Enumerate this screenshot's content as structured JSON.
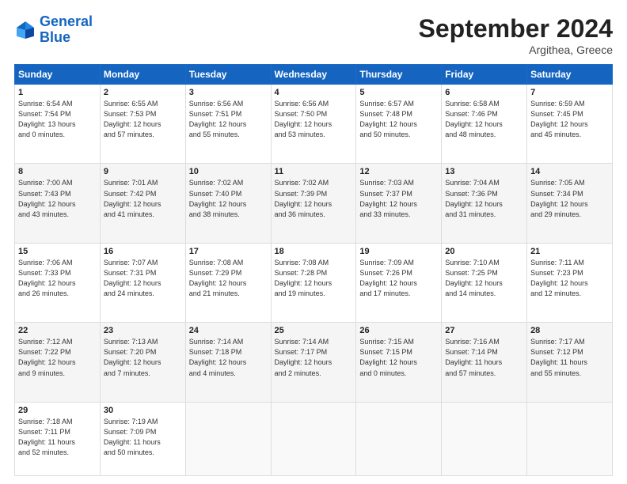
{
  "logo": {
    "text_general": "General",
    "text_blue": "Blue"
  },
  "header": {
    "month": "September 2024",
    "location": "Argithea, Greece"
  },
  "weekdays": [
    "Sunday",
    "Monday",
    "Tuesday",
    "Wednesday",
    "Thursday",
    "Friday",
    "Saturday"
  ],
  "weeks": [
    [
      {
        "day": "1",
        "info": "Sunrise: 6:54 AM\nSunset: 7:54 PM\nDaylight: 13 hours\nand 0 minutes."
      },
      {
        "day": "2",
        "info": "Sunrise: 6:55 AM\nSunset: 7:53 PM\nDaylight: 12 hours\nand 57 minutes."
      },
      {
        "day": "3",
        "info": "Sunrise: 6:56 AM\nSunset: 7:51 PM\nDaylight: 12 hours\nand 55 minutes."
      },
      {
        "day": "4",
        "info": "Sunrise: 6:56 AM\nSunset: 7:50 PM\nDaylight: 12 hours\nand 53 minutes."
      },
      {
        "day": "5",
        "info": "Sunrise: 6:57 AM\nSunset: 7:48 PM\nDaylight: 12 hours\nand 50 minutes."
      },
      {
        "day": "6",
        "info": "Sunrise: 6:58 AM\nSunset: 7:46 PM\nDaylight: 12 hours\nand 48 minutes."
      },
      {
        "day": "7",
        "info": "Sunrise: 6:59 AM\nSunset: 7:45 PM\nDaylight: 12 hours\nand 45 minutes."
      }
    ],
    [
      {
        "day": "8",
        "info": "Sunrise: 7:00 AM\nSunset: 7:43 PM\nDaylight: 12 hours\nand 43 minutes."
      },
      {
        "day": "9",
        "info": "Sunrise: 7:01 AM\nSunset: 7:42 PM\nDaylight: 12 hours\nand 41 minutes."
      },
      {
        "day": "10",
        "info": "Sunrise: 7:02 AM\nSunset: 7:40 PM\nDaylight: 12 hours\nand 38 minutes."
      },
      {
        "day": "11",
        "info": "Sunrise: 7:02 AM\nSunset: 7:39 PM\nDaylight: 12 hours\nand 36 minutes."
      },
      {
        "day": "12",
        "info": "Sunrise: 7:03 AM\nSunset: 7:37 PM\nDaylight: 12 hours\nand 33 minutes."
      },
      {
        "day": "13",
        "info": "Sunrise: 7:04 AM\nSunset: 7:36 PM\nDaylight: 12 hours\nand 31 minutes."
      },
      {
        "day": "14",
        "info": "Sunrise: 7:05 AM\nSunset: 7:34 PM\nDaylight: 12 hours\nand 29 minutes."
      }
    ],
    [
      {
        "day": "15",
        "info": "Sunrise: 7:06 AM\nSunset: 7:33 PM\nDaylight: 12 hours\nand 26 minutes."
      },
      {
        "day": "16",
        "info": "Sunrise: 7:07 AM\nSunset: 7:31 PM\nDaylight: 12 hours\nand 24 minutes."
      },
      {
        "day": "17",
        "info": "Sunrise: 7:08 AM\nSunset: 7:29 PM\nDaylight: 12 hours\nand 21 minutes."
      },
      {
        "day": "18",
        "info": "Sunrise: 7:08 AM\nSunset: 7:28 PM\nDaylight: 12 hours\nand 19 minutes."
      },
      {
        "day": "19",
        "info": "Sunrise: 7:09 AM\nSunset: 7:26 PM\nDaylight: 12 hours\nand 17 minutes."
      },
      {
        "day": "20",
        "info": "Sunrise: 7:10 AM\nSunset: 7:25 PM\nDaylight: 12 hours\nand 14 minutes."
      },
      {
        "day": "21",
        "info": "Sunrise: 7:11 AM\nSunset: 7:23 PM\nDaylight: 12 hours\nand 12 minutes."
      }
    ],
    [
      {
        "day": "22",
        "info": "Sunrise: 7:12 AM\nSunset: 7:22 PM\nDaylight: 12 hours\nand 9 minutes."
      },
      {
        "day": "23",
        "info": "Sunrise: 7:13 AM\nSunset: 7:20 PM\nDaylight: 12 hours\nand 7 minutes."
      },
      {
        "day": "24",
        "info": "Sunrise: 7:14 AM\nSunset: 7:18 PM\nDaylight: 12 hours\nand 4 minutes."
      },
      {
        "day": "25",
        "info": "Sunrise: 7:14 AM\nSunset: 7:17 PM\nDaylight: 12 hours\nand 2 minutes."
      },
      {
        "day": "26",
        "info": "Sunrise: 7:15 AM\nSunset: 7:15 PM\nDaylight: 12 hours\nand 0 minutes."
      },
      {
        "day": "27",
        "info": "Sunrise: 7:16 AM\nSunset: 7:14 PM\nDaylight: 11 hours\nand 57 minutes."
      },
      {
        "day": "28",
        "info": "Sunrise: 7:17 AM\nSunset: 7:12 PM\nDaylight: 11 hours\nand 55 minutes."
      }
    ],
    [
      {
        "day": "29",
        "info": "Sunrise: 7:18 AM\nSunset: 7:11 PM\nDaylight: 11 hours\nand 52 minutes."
      },
      {
        "day": "30",
        "info": "Sunrise: 7:19 AM\nSunset: 7:09 PM\nDaylight: 11 hours\nand 50 minutes."
      },
      {
        "day": "",
        "info": ""
      },
      {
        "day": "",
        "info": ""
      },
      {
        "day": "",
        "info": ""
      },
      {
        "day": "",
        "info": ""
      },
      {
        "day": "",
        "info": ""
      }
    ]
  ]
}
